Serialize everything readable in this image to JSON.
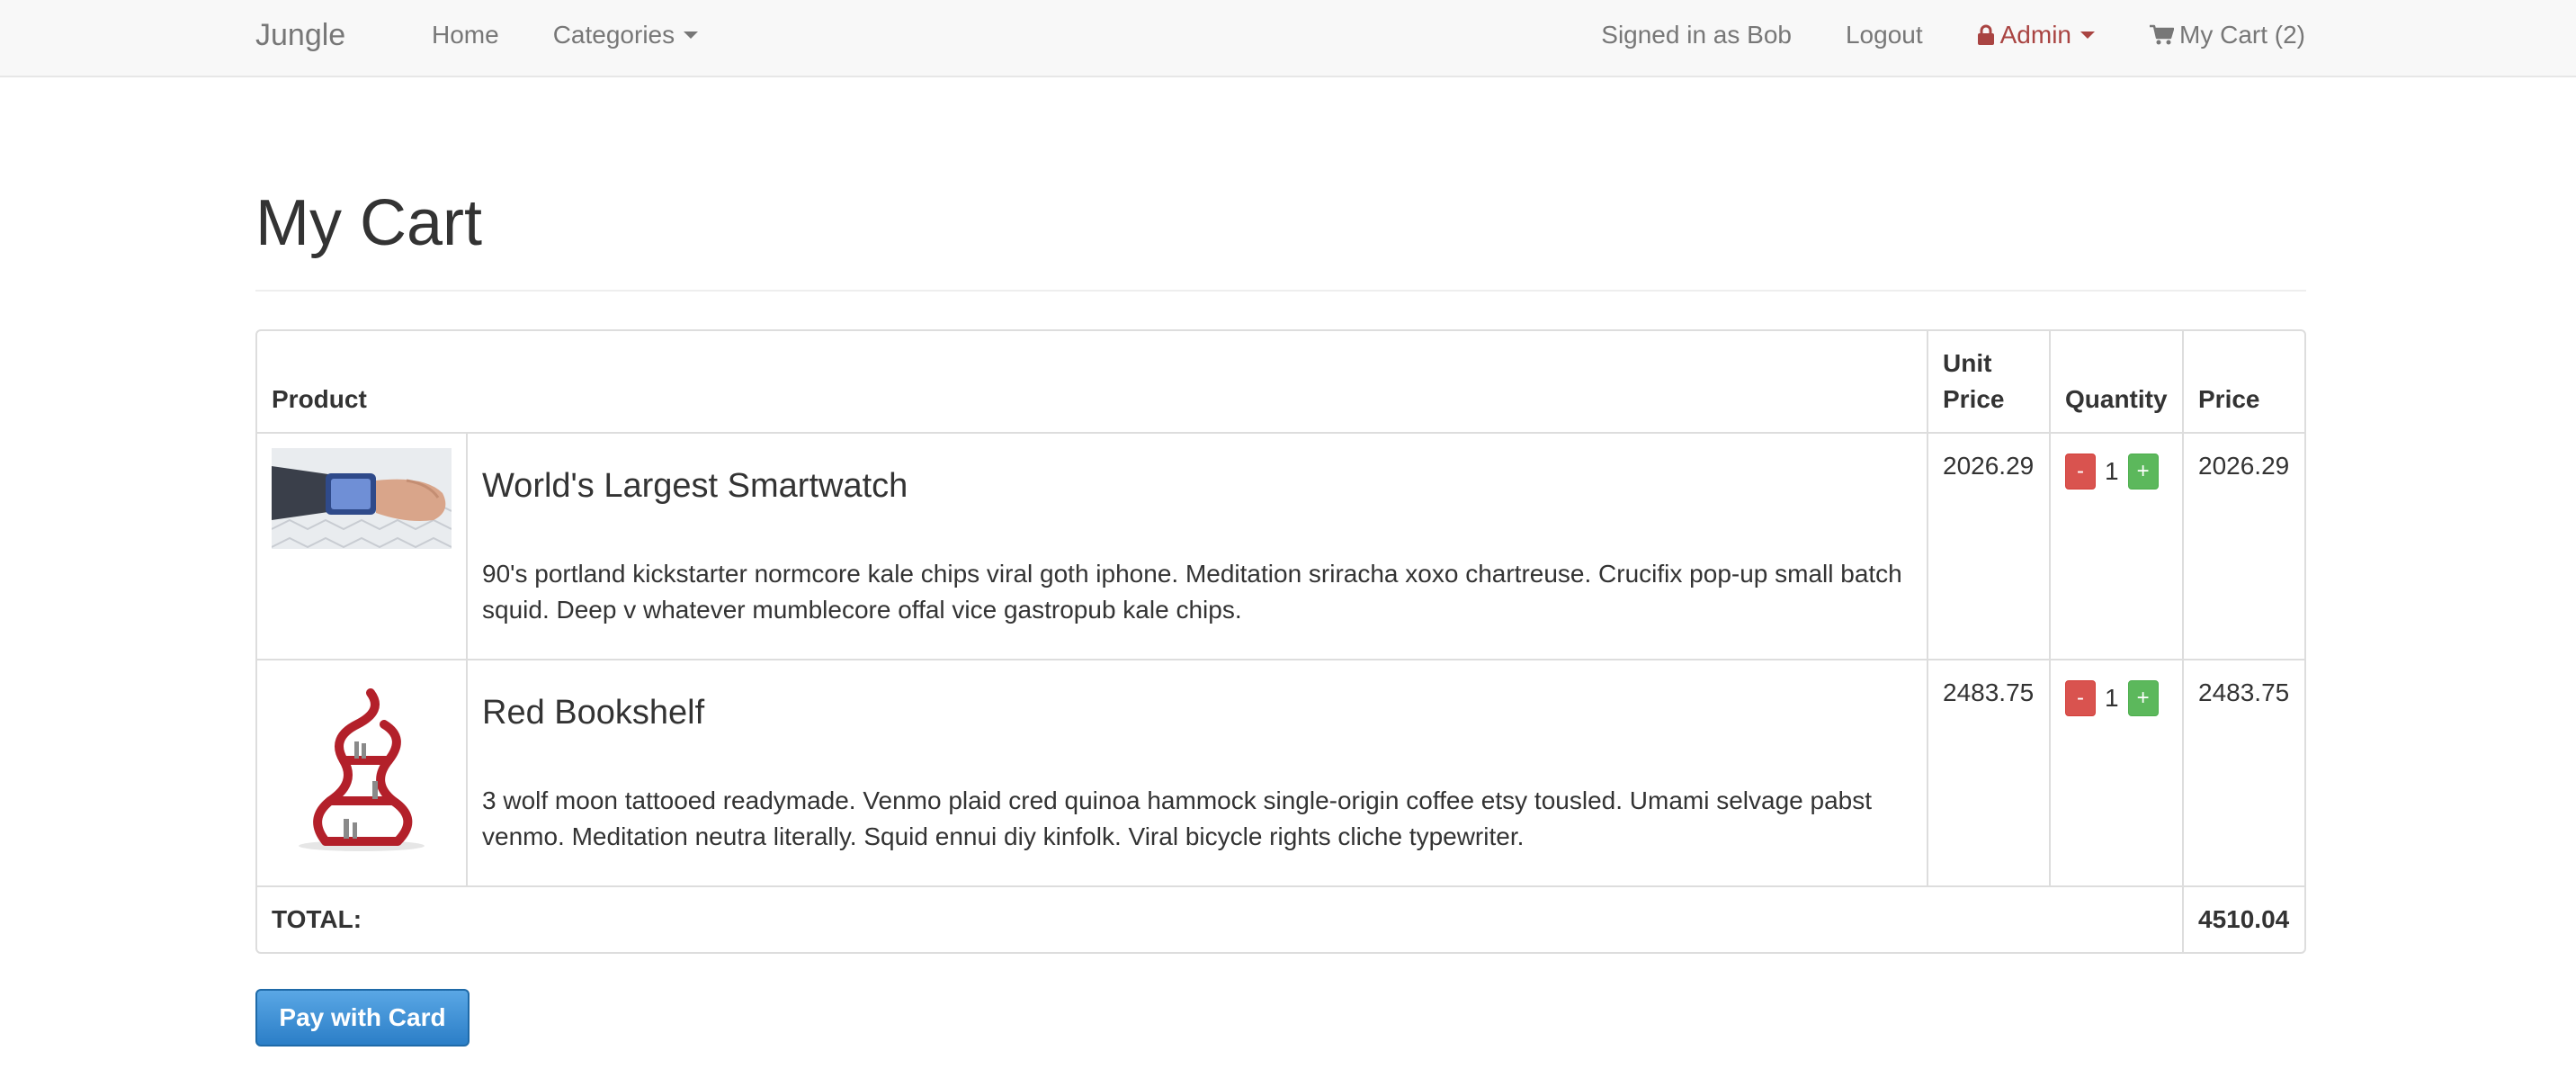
{
  "navbar": {
    "brand": "Jungle",
    "home": "Home",
    "categories": "Categories",
    "signed_in": "Signed in as Bob",
    "logout": "Logout",
    "admin": "Admin",
    "cart": "My Cart (2)",
    "admin_color": "#a94442"
  },
  "page": {
    "title": "My Cart"
  },
  "table": {
    "headers": {
      "product": "Product",
      "unit_price": "Unit Price",
      "quantity": "Quantity",
      "price": "Price"
    },
    "items": [
      {
        "name": "World's Largest Smartwatch",
        "description": "90's portland kickstarter normcore kale chips viral goth iphone. Meditation sriracha xoxo chartreuse. Crucifix pop-up small batch squid. Deep v whatever mumblecore offal vice gastropub kale chips.",
        "unit_price": "2026.29",
        "quantity": "1",
        "price": "2026.29",
        "minus": "-",
        "plus": "+"
      },
      {
        "name": "Red Bookshelf",
        "description": "3 wolf moon tattooed readymade. Venmo plaid cred quinoa hammock single-origin coffee etsy tousled. Umami selvage pabst venmo. Meditation neutra literally. Squid ennui diy kinfolk. Viral bicycle rights cliche typewriter.",
        "unit_price": "2483.75",
        "quantity": "1",
        "price": "2483.75",
        "minus": "-",
        "plus": "+"
      }
    ],
    "total_label": "TOTAL:",
    "total_value": "4510.04"
  },
  "pay_button": "Pay with Card"
}
